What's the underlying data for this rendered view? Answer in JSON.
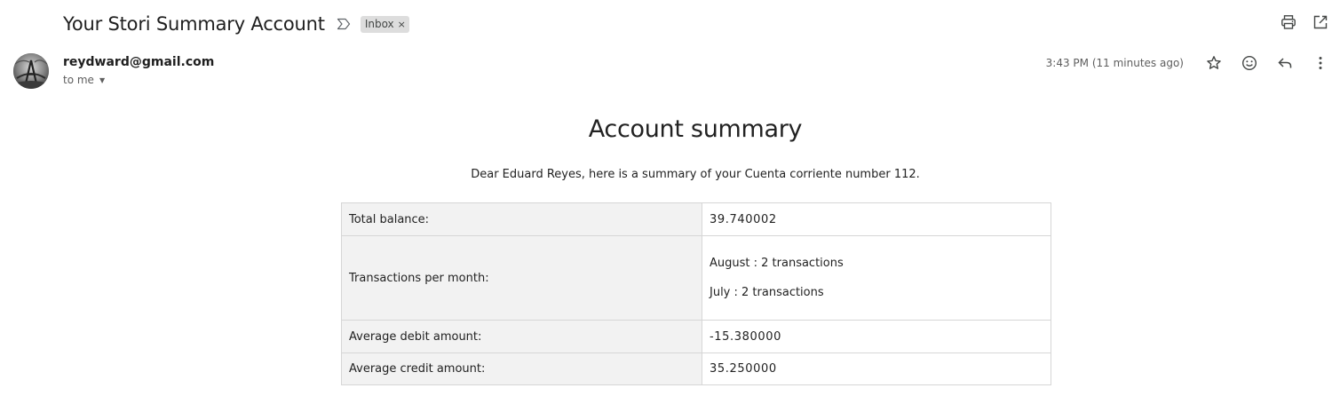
{
  "email": {
    "subject": "Your Stori Summary Account",
    "label_chip": "Inbox",
    "label_chip_close": "×",
    "sender_email": "reydward@gmail.com",
    "recipient_text": "to me",
    "timestamp": "3:43 PM (11 minutes ago)"
  },
  "icons": {
    "importance": "importance-marker-icon",
    "print": "print-icon",
    "new_window": "open-in-new-window-icon",
    "star": "star-icon",
    "emoji": "emoji-reaction-icon",
    "reply": "reply-icon",
    "more": "more-vert-icon"
  },
  "body": {
    "title": "Account summary",
    "intro": "Dear Eduard Reyes, here is a summary of your Cuenta corriente number 112.",
    "rows": [
      {
        "label": "Total balance:",
        "value": "39.740002"
      },
      {
        "label": "Transactions per month:",
        "months": [
          "August : 2 transactions",
          "July : 2 transactions"
        ]
      },
      {
        "label": "Average debit amount:",
        "value": "-15.380000"
      },
      {
        "label": "Average credit amount:",
        "value": "35.250000"
      }
    ]
  },
  "colors": {
    "label_chip_bg": "#dddddd",
    "table_key_bg": "#f2f2f2",
    "table_border": "#d6d6d6"
  }
}
